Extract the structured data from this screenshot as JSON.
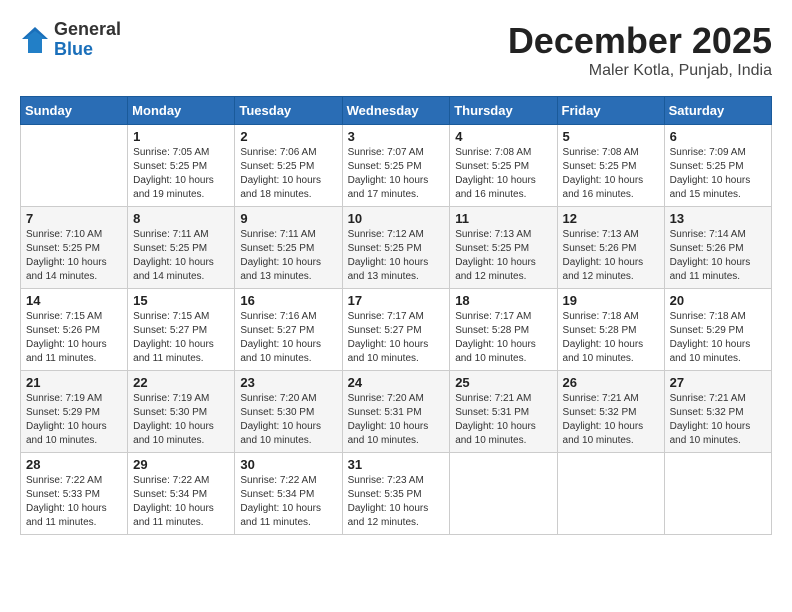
{
  "logo": {
    "general": "General",
    "blue": "Blue"
  },
  "title": "December 2025",
  "location": "Maler Kotla, Punjab, India",
  "headers": [
    "Sunday",
    "Monday",
    "Tuesday",
    "Wednesday",
    "Thursday",
    "Friday",
    "Saturday"
  ],
  "weeks": [
    [
      {
        "day": "",
        "info": ""
      },
      {
        "day": "1",
        "info": "Sunrise: 7:05 AM\nSunset: 5:25 PM\nDaylight: 10 hours\nand 19 minutes."
      },
      {
        "day": "2",
        "info": "Sunrise: 7:06 AM\nSunset: 5:25 PM\nDaylight: 10 hours\nand 18 minutes."
      },
      {
        "day": "3",
        "info": "Sunrise: 7:07 AM\nSunset: 5:25 PM\nDaylight: 10 hours\nand 17 minutes."
      },
      {
        "day": "4",
        "info": "Sunrise: 7:08 AM\nSunset: 5:25 PM\nDaylight: 10 hours\nand 16 minutes."
      },
      {
        "day": "5",
        "info": "Sunrise: 7:08 AM\nSunset: 5:25 PM\nDaylight: 10 hours\nand 16 minutes."
      },
      {
        "day": "6",
        "info": "Sunrise: 7:09 AM\nSunset: 5:25 PM\nDaylight: 10 hours\nand 15 minutes."
      }
    ],
    [
      {
        "day": "7",
        "info": "Sunrise: 7:10 AM\nSunset: 5:25 PM\nDaylight: 10 hours\nand 14 minutes."
      },
      {
        "day": "8",
        "info": "Sunrise: 7:11 AM\nSunset: 5:25 PM\nDaylight: 10 hours\nand 14 minutes."
      },
      {
        "day": "9",
        "info": "Sunrise: 7:11 AM\nSunset: 5:25 PM\nDaylight: 10 hours\nand 13 minutes."
      },
      {
        "day": "10",
        "info": "Sunrise: 7:12 AM\nSunset: 5:25 PM\nDaylight: 10 hours\nand 13 minutes."
      },
      {
        "day": "11",
        "info": "Sunrise: 7:13 AM\nSunset: 5:25 PM\nDaylight: 10 hours\nand 12 minutes."
      },
      {
        "day": "12",
        "info": "Sunrise: 7:13 AM\nSunset: 5:26 PM\nDaylight: 10 hours\nand 12 minutes."
      },
      {
        "day": "13",
        "info": "Sunrise: 7:14 AM\nSunset: 5:26 PM\nDaylight: 10 hours\nand 11 minutes."
      }
    ],
    [
      {
        "day": "14",
        "info": "Sunrise: 7:15 AM\nSunset: 5:26 PM\nDaylight: 10 hours\nand 11 minutes."
      },
      {
        "day": "15",
        "info": "Sunrise: 7:15 AM\nSunset: 5:27 PM\nDaylight: 10 hours\nand 11 minutes."
      },
      {
        "day": "16",
        "info": "Sunrise: 7:16 AM\nSunset: 5:27 PM\nDaylight: 10 hours\nand 10 minutes."
      },
      {
        "day": "17",
        "info": "Sunrise: 7:17 AM\nSunset: 5:27 PM\nDaylight: 10 hours\nand 10 minutes."
      },
      {
        "day": "18",
        "info": "Sunrise: 7:17 AM\nSunset: 5:28 PM\nDaylight: 10 hours\nand 10 minutes."
      },
      {
        "day": "19",
        "info": "Sunrise: 7:18 AM\nSunset: 5:28 PM\nDaylight: 10 hours\nand 10 minutes."
      },
      {
        "day": "20",
        "info": "Sunrise: 7:18 AM\nSunset: 5:29 PM\nDaylight: 10 hours\nand 10 minutes."
      }
    ],
    [
      {
        "day": "21",
        "info": "Sunrise: 7:19 AM\nSunset: 5:29 PM\nDaylight: 10 hours\nand 10 minutes."
      },
      {
        "day": "22",
        "info": "Sunrise: 7:19 AM\nSunset: 5:30 PM\nDaylight: 10 hours\nand 10 minutes."
      },
      {
        "day": "23",
        "info": "Sunrise: 7:20 AM\nSunset: 5:30 PM\nDaylight: 10 hours\nand 10 minutes."
      },
      {
        "day": "24",
        "info": "Sunrise: 7:20 AM\nSunset: 5:31 PM\nDaylight: 10 hours\nand 10 minutes."
      },
      {
        "day": "25",
        "info": "Sunrise: 7:21 AM\nSunset: 5:31 PM\nDaylight: 10 hours\nand 10 minutes."
      },
      {
        "day": "26",
        "info": "Sunrise: 7:21 AM\nSunset: 5:32 PM\nDaylight: 10 hours\nand 10 minutes."
      },
      {
        "day": "27",
        "info": "Sunrise: 7:21 AM\nSunset: 5:32 PM\nDaylight: 10 hours\nand 10 minutes."
      }
    ],
    [
      {
        "day": "28",
        "info": "Sunrise: 7:22 AM\nSunset: 5:33 PM\nDaylight: 10 hours\nand 11 minutes."
      },
      {
        "day": "29",
        "info": "Sunrise: 7:22 AM\nSunset: 5:34 PM\nDaylight: 10 hours\nand 11 minutes."
      },
      {
        "day": "30",
        "info": "Sunrise: 7:22 AM\nSunset: 5:34 PM\nDaylight: 10 hours\nand 11 minutes."
      },
      {
        "day": "31",
        "info": "Sunrise: 7:23 AM\nSunset: 5:35 PM\nDaylight: 10 hours\nand 12 minutes."
      },
      {
        "day": "",
        "info": ""
      },
      {
        "day": "",
        "info": ""
      },
      {
        "day": "",
        "info": ""
      }
    ]
  ]
}
